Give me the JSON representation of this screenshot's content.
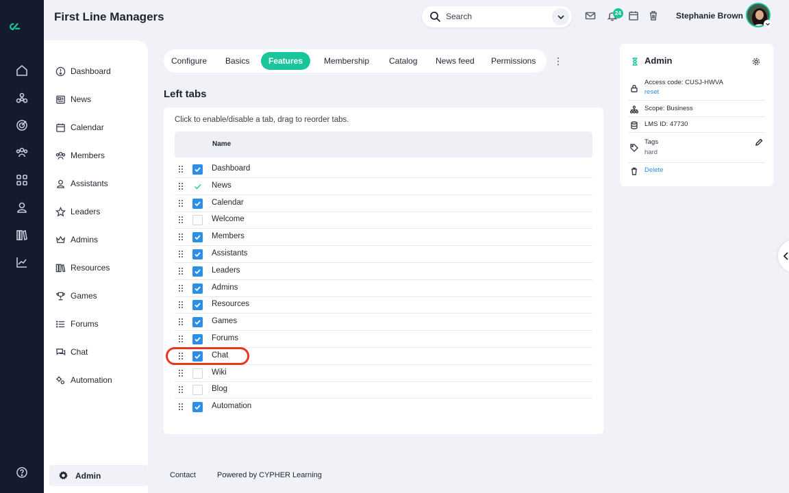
{
  "header": {
    "title": "First Line Managers",
    "search_placeholder": "Search",
    "notification_count": "24",
    "user_name": "Stephanie Brown"
  },
  "menu": {
    "items": [
      {
        "label": "Dashboard",
        "icon": "dashboard-icon"
      },
      {
        "label": "News",
        "icon": "news-icon"
      },
      {
        "label": "Calendar",
        "icon": "calendar-icon"
      },
      {
        "label": "Members",
        "icon": "members-icon"
      },
      {
        "label": "Assistants",
        "icon": "assistants-icon"
      },
      {
        "label": "Leaders",
        "icon": "star-icon"
      },
      {
        "label": "Admins",
        "icon": "crown-icon"
      },
      {
        "label": "Resources",
        "icon": "books-icon"
      },
      {
        "label": "Games",
        "icon": "trophy-icon"
      },
      {
        "label": "Forums",
        "icon": "list-icon"
      },
      {
        "label": "Chat",
        "icon": "chat-icon"
      },
      {
        "label": "Automation",
        "icon": "gears-icon"
      }
    ],
    "admin_label": "Admin"
  },
  "tabs": {
    "items": [
      "Configure",
      "Basics",
      "Features",
      "Membership",
      "Catalog",
      "News feed",
      "Permissions"
    ],
    "active": "Features"
  },
  "section": {
    "title": "Left tabs",
    "instructions": "Click to enable/disable a tab, drag to reorder tabs.",
    "column_name": "Name",
    "rows": [
      {
        "label": "Dashboard",
        "state": "checked"
      },
      {
        "label": "News",
        "state": "locked"
      },
      {
        "label": "Calendar",
        "state": "checked"
      },
      {
        "label": "Welcome",
        "state": "unchecked"
      },
      {
        "label": "Members",
        "state": "checked"
      },
      {
        "label": "Assistants",
        "state": "checked"
      },
      {
        "label": "Leaders",
        "state": "checked"
      },
      {
        "label": "Admins",
        "state": "checked"
      },
      {
        "label": "Resources",
        "state": "checked"
      },
      {
        "label": "Games",
        "state": "checked"
      },
      {
        "label": "Forums",
        "state": "checked"
      },
      {
        "label": "Chat",
        "state": "checked"
      },
      {
        "label": "Wiki",
        "state": "unchecked"
      },
      {
        "label": "Blog",
        "state": "unchecked"
      },
      {
        "label": "Automation",
        "state": "checked"
      }
    ]
  },
  "footer": {
    "contact": "Contact",
    "powered_by": "Powered by CYPHER Learning"
  },
  "admin_panel": {
    "title": "Admin",
    "access_code": "Access code: CUSJ-HWVA",
    "reset_link": "reset",
    "scope": "Scope: Business",
    "lms_id": "LMS ID: 47730",
    "tags_label": "Tags",
    "tags_value": "hard",
    "delete_link": "Delete"
  },
  "colors": {
    "accent": "#1bc59b",
    "checkbox": "#2d8ee8",
    "highlight": "#e8361c",
    "rail": "#141b2d"
  }
}
